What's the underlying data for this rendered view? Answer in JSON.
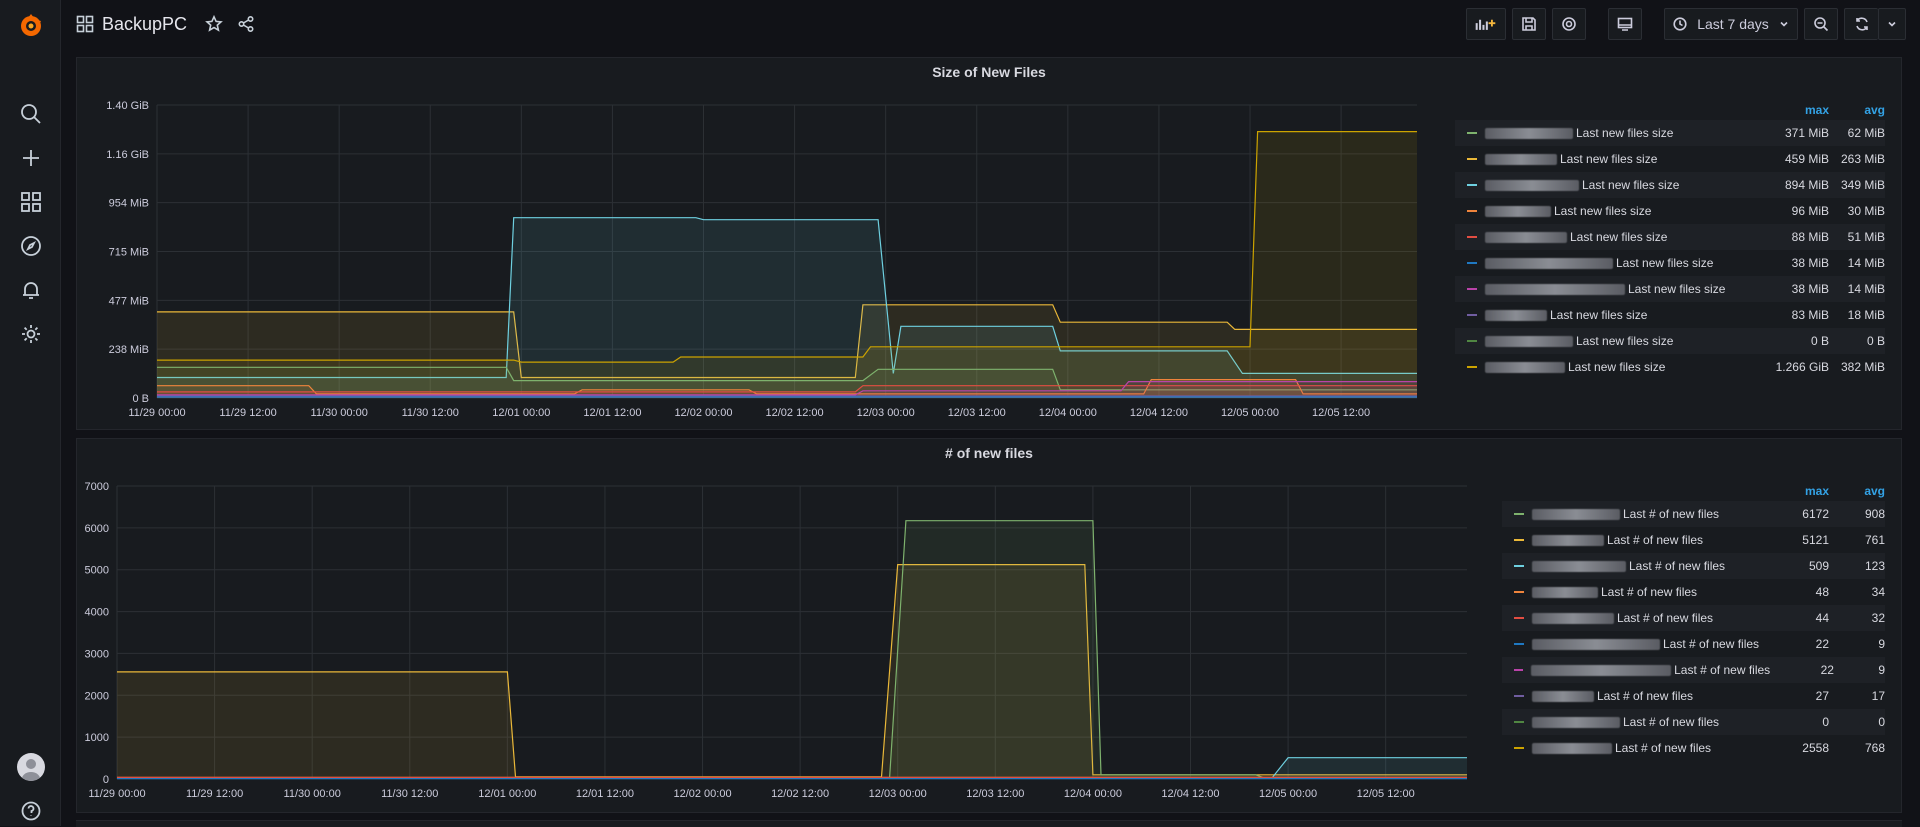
{
  "dashboard": {
    "title": "BackupPC",
    "time_range": "Last 7 days"
  },
  "icons": {
    "sidebar": [
      "grafana-logo-icon",
      "search-icon",
      "plus-icon",
      "dashboards-icon",
      "explore-icon",
      "alerting-icon",
      "configuration-icon",
      "profile-avatar-icon",
      "help-icon"
    ],
    "toolbar": [
      "add-panel-icon",
      "save-icon",
      "settings-icon",
      "tv-mode-icon",
      "clock-icon",
      "zoom-out-icon",
      "refresh-icon",
      "chevron-down-icon"
    ]
  },
  "colors": {
    "c0": "#73bf69",
    "c1": "#fade2a",
    "c2": "#5794f2",
    "c3": "#ff9830",
    "c4": "#f2495c",
    "c5": "#5794f2",
    "c6": "#b877d9",
    "c7": "#705da0",
    "c8": "#37872d",
    "c9": "#fade2a",
    "cyan": "#6ed0e0"
  },
  "panels": [
    {
      "title": "Size of New Files",
      "legend_headers": [
        "max",
        "avg"
      ],
      "series_suffix": "Last new files size",
      "legend": [
        {
          "color": "#7eb26d",
          "max": "371 MiB",
          "avg": "62 MiB"
        },
        {
          "color": "#eab839",
          "max": "459 MiB",
          "avg": "263 MiB"
        },
        {
          "color": "#6ed0e0",
          "max": "894 MiB",
          "avg": "349 MiB"
        },
        {
          "color": "#ef843c",
          "max": "96 MiB",
          "avg": "30 MiB"
        },
        {
          "color": "#e24d42",
          "max": "88 MiB",
          "avg": "51 MiB"
        },
        {
          "color": "#1f78c1",
          "max": "38 MiB",
          "avg": "14 MiB"
        },
        {
          "color": "#ba43a9",
          "max": "38 MiB",
          "avg": "14 MiB"
        },
        {
          "color": "#705da0",
          "max": "83 MiB",
          "avg": "18 MiB"
        },
        {
          "color": "#508642",
          "max": "0 B",
          "avg": "0 B"
        },
        {
          "color": "#cca300",
          "max": "1.266 GiB",
          "avg": "382 MiB"
        }
      ]
    },
    {
      "title": "# of new files",
      "legend_headers": [
        "max",
        "avg"
      ],
      "series_suffix": "Last # of new files",
      "legend": [
        {
          "color": "#7eb26d",
          "max": "6172",
          "avg": "908"
        },
        {
          "color": "#eab839",
          "max": "5121",
          "avg": "761"
        },
        {
          "color": "#6ed0e0",
          "max": "509",
          "avg": "123"
        },
        {
          "color": "#ef843c",
          "max": "48",
          "avg": "34"
        },
        {
          "color": "#e24d42",
          "max": "44",
          "avg": "32"
        },
        {
          "color": "#1f78c1",
          "max": "22",
          "avg": "9"
        },
        {
          "color": "#ba43a9",
          "max": "22",
          "avg": "9"
        },
        {
          "color": "#705da0",
          "max": "27",
          "avg": "17"
        },
        {
          "color": "#508642",
          "max": "0",
          "avg": "0"
        },
        {
          "color": "#cca300",
          "max": "2558",
          "avg": "768"
        }
      ]
    }
  ],
  "chart_data": [
    {
      "type": "line",
      "title": "Size of New Files",
      "y_tick_labels": [
        "0 B",
        "238 MiB",
        "477 MiB",
        "715 MiB",
        "954 MiB",
        "1.16 GiB",
        "1.40 GiB"
      ],
      "x_tick_labels": [
        "11/29 00:00",
        "11/29 12:00",
        "11/30 00:00",
        "11/30 12:00",
        "12/01 00:00",
        "12/01 12:00",
        "12/02 00:00",
        "12/02 12:00",
        "12/03 00:00",
        "12/03 12:00",
        "12/04 00:00",
        "12/04 12:00",
        "12/05 00:00",
        "12/05 12:00"
      ],
      "x_unit": "hours since 11/29 00:00",
      "y_unit": "MiB",
      "ylim": [
        0,
        1430
      ],
      "xlim": [
        0,
        166
      ],
      "series": [
        {
          "color": "#eab839",
          "points": [
            [
              0,
              420
            ],
            [
              47,
              420
            ],
            [
              48,
              100
            ],
            [
              92,
              100
            ],
            [
              93,
              455
            ],
            [
              118,
              455
            ],
            [
              119,
              370
            ],
            [
              141,
              370
            ],
            [
              142,
              335
            ],
            [
              166,
              335
            ]
          ]
        },
        {
          "color": "#6ed0e0",
          "points": [
            [
              0,
              100
            ],
            [
              46,
              100
            ],
            [
              47,
              880
            ],
            [
              71,
              880
            ],
            [
              72,
              870
            ],
            [
              95,
              870
            ],
            [
              97,
              120
            ],
            [
              98,
              350
            ],
            [
              118,
              350
            ],
            [
              119,
              230
            ],
            [
              141,
              230
            ],
            [
              143,
              120
            ],
            [
              166,
              120
            ]
          ]
        },
        {
          "color": "#cca300",
          "points": [
            [
              0,
              185
            ],
            [
              47,
              185
            ],
            [
              48,
              175
            ],
            [
              68,
              175
            ],
            [
              69,
              200
            ],
            [
              93,
              200
            ],
            [
              94,
              250
            ],
            [
              135,
              250
            ],
            [
              144,
              250
            ],
            [
              145,
              1300
            ],
            [
              166,
              1300
            ]
          ]
        },
        {
          "color": "#7eb26d",
          "points": [
            [
              0,
              150
            ],
            [
              46,
              150
            ],
            [
              47,
              85
            ],
            [
              93,
              85
            ],
            [
              95,
              140
            ],
            [
              118,
              140
            ],
            [
              119,
              40
            ],
            [
              166,
              40
            ]
          ]
        },
        {
          "color": "#ef843c",
          "points": [
            [
              0,
              60
            ],
            [
              20,
              60
            ],
            [
              21,
              20
            ],
            [
              55,
              20
            ],
            [
              56,
              40
            ],
            [
              78,
              40
            ],
            [
              79,
              20
            ],
            [
              130,
              20
            ],
            [
              131,
              90
            ],
            [
              150,
              90
            ],
            [
              151,
              20
            ],
            [
              166,
              20
            ]
          ]
        },
        {
          "color": "#e24d42",
          "points": [
            [
              0,
              30
            ],
            [
              92,
              30
            ],
            [
              93,
              60
            ],
            [
              166,
              60
            ]
          ]
        },
        {
          "color": "#ba43a9",
          "points": [
            [
              0,
              15
            ],
            [
              92,
              15
            ],
            [
              93,
              35
            ],
            [
              127,
              35
            ],
            [
              128,
              80
            ],
            [
              166,
              80
            ]
          ]
        },
        {
          "color": "#705da0",
          "points": [
            [
              0,
              10
            ],
            [
              166,
              10
            ]
          ]
        },
        {
          "color": "#1f78c1",
          "points": [
            [
              0,
              5
            ],
            [
              166,
              5
            ]
          ]
        }
      ]
    },
    {
      "type": "line",
      "title": "# of new files",
      "y_tick_labels": [
        "0",
        "1000",
        "2000",
        "3000",
        "4000",
        "5000",
        "6000",
        "7000"
      ],
      "x_tick_labels": [
        "11/29 00:00",
        "11/29 12:00",
        "11/30 00:00",
        "11/30 12:00",
        "12/01 00:00",
        "12/01 12:00",
        "12/02 00:00",
        "12/02 12:00",
        "12/03 00:00",
        "12/03 12:00",
        "12/04 00:00",
        "12/04 12:00",
        "12/05 00:00",
        "12/05 12:00"
      ],
      "x_unit": "hours since 11/29 00:00",
      "ylim": [
        0,
        7000
      ],
      "xlim": [
        0,
        166
      ],
      "series": [
        {
          "color": "#eab839",
          "points": [
            [
              0,
              2558
            ],
            [
              48,
              2558
            ],
            [
              49,
              50
            ],
            [
              94,
              50
            ],
            [
              96,
              5121
            ],
            [
              119,
              5121
            ],
            [
              120,
              100
            ],
            [
              166,
              100
            ]
          ]
        },
        {
          "color": "#7eb26d",
          "points": [
            [
              0,
              30
            ],
            [
              95,
              30
            ],
            [
              97,
              6172
            ],
            [
              120,
              6172
            ],
            [
              121,
              100
            ],
            [
              140,
              100
            ],
            [
              141,
              30
            ],
            [
              166,
              30
            ]
          ]
        },
        {
          "color": "#6ed0e0",
          "points": [
            [
              0,
              20
            ],
            [
              142,
              20
            ],
            [
              144,
              509
            ],
            [
              166,
              509
            ]
          ]
        },
        {
          "color": "#ef843c",
          "points": [
            [
              0,
              40
            ],
            [
              166,
              40
            ]
          ]
        },
        {
          "color": "#e24d42",
          "points": [
            [
              0,
              35
            ],
            [
              166,
              35
            ]
          ]
        },
        {
          "color": "#1f78c1",
          "points": [
            [
              0,
              10
            ],
            [
              166,
              10
            ]
          ]
        }
      ]
    }
  ]
}
